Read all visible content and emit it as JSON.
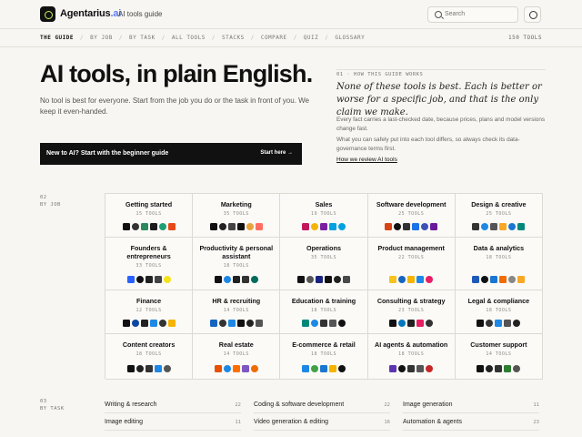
{
  "header": {
    "brand_main": "Agentarius",
    "brand_accent": ".ai",
    "brand_sub": "AI tools guide",
    "search_placeholder": "Search"
  },
  "nav": {
    "items": [
      "THE GUIDE",
      "BY JOB",
      "BY TASK",
      "ALL TOOLS",
      "STACKS",
      "COMPARE",
      "QUIZ",
      "GLOSSARY"
    ],
    "count": "150 TOOLS"
  },
  "hero": {
    "title": "AI tools, in plain English.",
    "text": "No tool is best for everyone. Start from the job you do or the task in front of you. We keep it even-handed.",
    "cta_left": "New to AI? Start with the beginner guide",
    "cta_right": "Start here →"
  },
  "howto": {
    "label": "01 · HOW THIS GUIDE WORKS",
    "quote": "None of these tools is best. Each is better or worse for a specific job, and that is the only claim we make.",
    "p1": "Every fact carries a last-checked date, because prices, plans and model versions change fast.",
    "p2": "What you can safely put into each tool differs, so always check its data-governance terms first.",
    "link": "How we review AI tools"
  },
  "sections": {
    "by_job_num": "02",
    "by_job": "BY JOB",
    "by_task_num": "03",
    "by_task": "BY TASK"
  },
  "jobs": [
    {
      "name": "Getting started",
      "count": "15 TOOLS",
      "icons": [
        "#111",
        "#333",
        "#2b8a5c",
        "#1c1c1c",
        "#1f9e74",
        "#e64a19"
      ]
    },
    {
      "name": "Marketing",
      "count": "35 TOOLS",
      "icons": [
        "#111",
        "#222",
        "#444",
        "#111",
        "#e8a33c",
        "#ff6f61"
      ]
    },
    {
      "name": "Sales",
      "count": "19 TOOLS",
      "icons": [
        "#c2185b",
        "#f4b400",
        "#7b1fa2",
        "#00a1e0",
        "#00a1e0"
      ]
    },
    {
      "name": "Software development",
      "count": "25 TOOLS",
      "icons": [
        "#d84315",
        "#111",
        "#333",
        "#1a73e8",
        "#3f51b5",
        "#6a1b9a"
      ]
    },
    {
      "name": "Design & creative",
      "count": "25 TOOLS",
      "icons": [
        "#333",
        "#1e88e5",
        "#555",
        "#f9a825",
        "#1976d2",
        "#00897b"
      ]
    },
    {
      "name": "Founders & entrepreneurs",
      "count": "33 TOOLS",
      "icons": [
        "#2962ff",
        "#111",
        "#222",
        "#444",
        "#f7e11a"
      ]
    },
    {
      "name": "Productivity & personal assistant",
      "count": "18 TOOLS",
      "icons": [
        "#111",
        "#1e88e5",
        "#222",
        "#333",
        "#006c5b"
      ]
    },
    {
      "name": "Operations",
      "count": "35 TOOLS",
      "icons": [
        "#111",
        "#555",
        "#1a237e",
        "#111",
        "#222",
        "#4a4a4a"
      ]
    },
    {
      "name": "Product management",
      "count": "22 TOOLS",
      "icons": [
        "#f9c21b",
        "#1565c0",
        "#f4b400",
        "#1e88e5",
        "#e91e63"
      ]
    },
    {
      "name": "Data & analytics",
      "count": "18 TOOLS",
      "icons": [
        "#1e5bb8",
        "#111",
        "#1976d2",
        "#ef6c00",
        "#888",
        "#f9a825"
      ]
    },
    {
      "name": "Finance",
      "count": "12 TOOLS",
      "icons": [
        "#111",
        "#0d47a1",
        "#222",
        "#1e88e5",
        "#333",
        "#f4b400"
      ]
    },
    {
      "name": "HR & recruiting",
      "count": "14 TOOLS",
      "icons": [
        "#1565c0",
        "#333",
        "#1e88e5",
        "#111",
        "#222",
        "#555"
      ]
    },
    {
      "name": "Education & training",
      "count": "18 TOOLS",
      "icons": [
        "#00897b",
        "#1e88e5",
        "#333",
        "#555",
        "#111"
      ]
    },
    {
      "name": "Consulting & strategy",
      "count": "23 TOOLS",
      "icons": [
        "#111",
        "#0277bd",
        "#222",
        "#e91e63",
        "#333"
      ]
    },
    {
      "name": "Legal & compliance",
      "count": "18 TOOLS",
      "icons": [
        "#111",
        "#333",
        "#1e88e5",
        "#555",
        "#222"
      ]
    },
    {
      "name": "Content creators",
      "count": "18 TOOLS",
      "icons": [
        "#111",
        "#222",
        "#333",
        "#1e88e5",
        "#555"
      ]
    },
    {
      "name": "Real estate",
      "count": "14 TOOLS",
      "icons": [
        "#e65100",
        "#1e88e5",
        "#ff6f00",
        "#7e57c2",
        "#ef6c00"
      ]
    },
    {
      "name": "E-commerce & retail",
      "count": "18 TOOLS",
      "icons": [
        "#1e88e5",
        "#43a047",
        "#1976d2",
        "#f4b400",
        "#111"
      ]
    },
    {
      "name": "AI agents & automation",
      "count": "18 TOOLS",
      "icons": [
        "#5e35b1",
        "#111",
        "#333",
        "#555",
        "#c62828"
      ]
    },
    {
      "name": "Customer support",
      "count": "14 TOOLS",
      "icons": [
        "#111",
        "#222",
        "#333",
        "#2e7d32",
        "#555"
      ]
    }
  ],
  "tasks": [
    {
      "name": "Writing & research",
      "count": "22"
    },
    {
      "name": "Coding & software development",
      "count": "22"
    },
    {
      "name": "Image generation",
      "count": "11"
    },
    {
      "name": "Image editing",
      "count": "11"
    },
    {
      "name": "Video generation & editing",
      "count": "16"
    },
    {
      "name": "Automation & agents",
      "count": "23"
    }
  ]
}
